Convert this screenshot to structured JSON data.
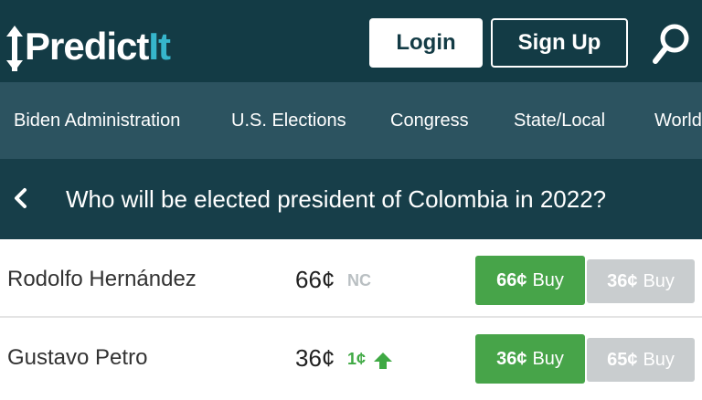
{
  "header": {
    "logo_text": "Predict",
    "logo_text_accent": "It",
    "login_label": "Login",
    "signup_label": "Sign Up"
  },
  "nav": {
    "items": [
      "Biden Administration",
      "U.S. Elections",
      "Congress",
      "State/Local",
      "World"
    ]
  },
  "market": {
    "title": "Who will be elected president of Colombia in 2022?"
  },
  "contracts": [
    {
      "name": "Rodolfo Hernández",
      "price": "66¢",
      "change": "NC",
      "change_direction": "none",
      "yes_price": "66¢",
      "yes_label": "Buy",
      "no_price": "36¢",
      "no_label": "Buy"
    },
    {
      "name": "Gustavo Petro",
      "price": "36¢",
      "change": "1¢",
      "change_direction": "up",
      "yes_price": "36¢",
      "yes_label": "Buy",
      "no_price": "65¢",
      "no_label": "Buy"
    }
  ],
  "colors": {
    "header_bg": "#133b45",
    "nav_bg": "#2c5360",
    "title_bg": "#173e49",
    "logo_accent": "#36b6cc",
    "buy_yes": "#47a449",
    "buy_no": "#c9cdcf",
    "change_up": "#3fa944",
    "change_nc": "#b9bfc2"
  },
  "icons": {
    "logo_arrow": "up-down-arrow-icon",
    "search": "search-icon",
    "back": "chevron-left-icon",
    "change_up": "up-arrow-icon"
  }
}
